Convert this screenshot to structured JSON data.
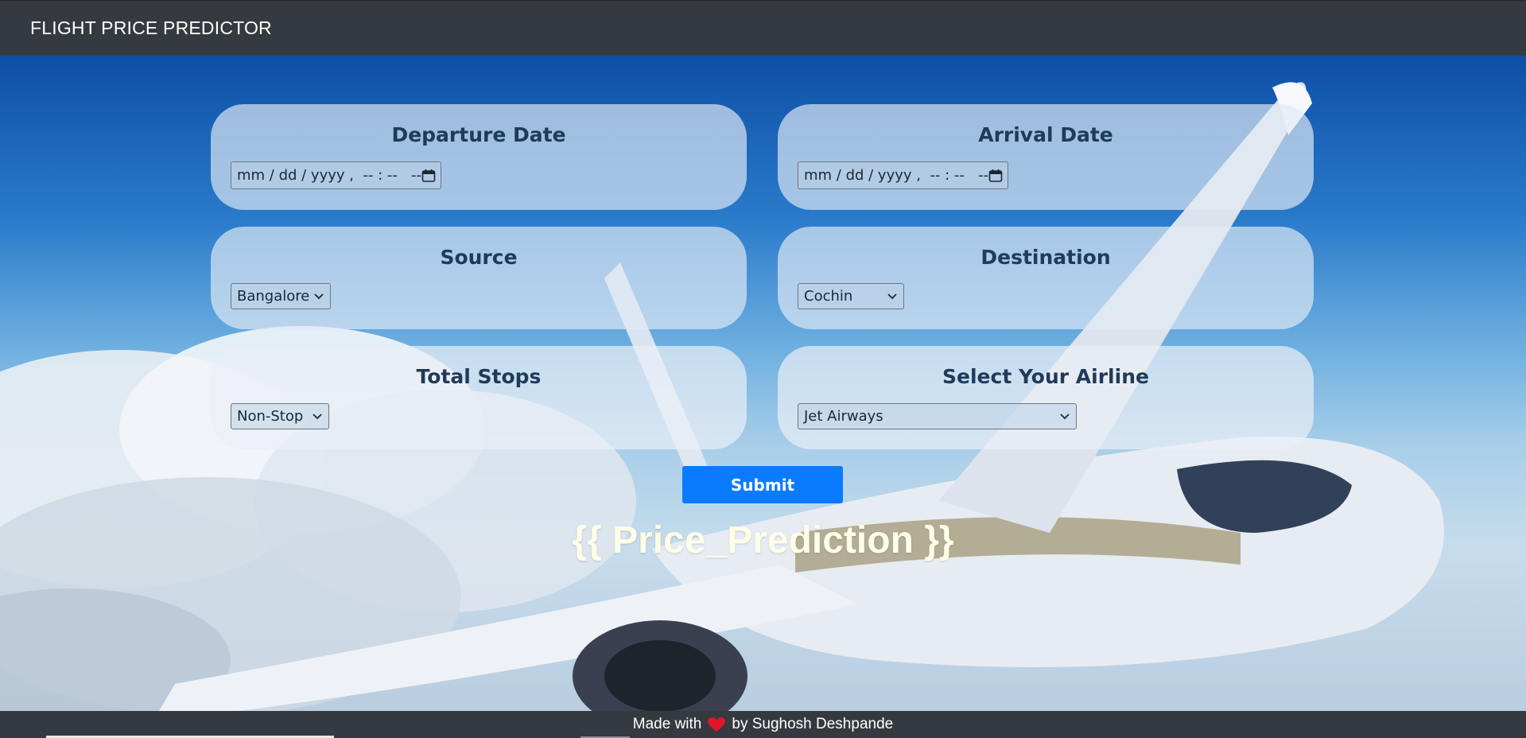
{
  "navbar": {
    "brand": "FLIGHT PRICE PREDICTOR"
  },
  "form": {
    "departure": {
      "label": "Departure Date",
      "placeholder": "mm / dd / yyyy ,  -- : --   --"
    },
    "arrival": {
      "label": "Arrival Date",
      "placeholder": "mm / dd / yyyy ,  -- : --   --"
    },
    "source": {
      "label": "Source",
      "selected": "Bangalore"
    },
    "destination": {
      "label": "Destination",
      "selected": "Cochin"
    },
    "stops": {
      "label": "Total Stops",
      "selected": "Non-Stop"
    },
    "airline": {
      "label": "Select Your Airline",
      "selected": "Jet Airways"
    },
    "submit_label": "Submit"
  },
  "prediction": {
    "text": "{{ Price_Prediction }}"
  },
  "footer": {
    "made_with": "Made with",
    "by": "by Sughosh Deshpande"
  },
  "colors": {
    "navbar": "#343a40",
    "submit": "#0a7bff",
    "heart": "#e0142a",
    "label": "#1f3b59"
  },
  "icons": {
    "calendar": "calendar-icon",
    "dropdown": "chevron-down-icon",
    "heart": "heart-icon"
  }
}
